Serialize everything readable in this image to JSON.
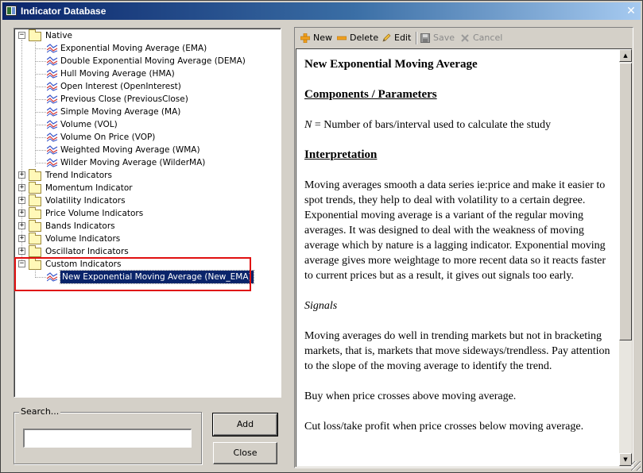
{
  "window": {
    "title": "Indicator Database",
    "close_glyph": "✕"
  },
  "tree": {
    "native": {
      "label": "Native",
      "items": [
        "Exponential Moving Average (EMA)",
        "Double Exponential Moving Average (DEMA)",
        "Hull Moving Average (HMA)",
        "Open Interest (OpenInterest)",
        "Previous Close (PreviousClose)",
        "Simple Moving Average (MA)",
        "Volume (VOL)",
        "Volume On Price (VOP)",
        "Weighted Moving Average (WMA)",
        "Wilder Moving Average (WilderMA)"
      ]
    },
    "collapsed_folders": [
      "Trend Indicators",
      "Momentum Indicator",
      "Volatility Indicators",
      "Price Volume Indicators",
      "Bands Indicators",
      "Volume Indicators",
      "Oscillator Indicators"
    ],
    "custom": {
      "label": "Custom Indicators",
      "items": [
        "New Exponential Moving Average (New_EMA)"
      ]
    },
    "expand_glyph": "+",
    "collapse_glyph": "−"
  },
  "search": {
    "label": "Search...",
    "value": ""
  },
  "buttons": {
    "add": "Add",
    "close": "Close"
  },
  "toolbar": {
    "new": "New",
    "delete": "Delete",
    "edit": "Edit",
    "save": "Save",
    "cancel": "Cancel"
  },
  "doc": {
    "title": "New Exponential Moving Average",
    "components_heading": "Components / Parameters",
    "param_symbol": "N",
    "param_text": " = Number of bars/interval used to calculate the study",
    "interpretation_heading": "Interpretation",
    "interpretation_text": "Moving averages smooth a data series ie:price and make it easier to spot trends, they help to deal with volatility to a certain degree. Exponential moving average is a variant of the regular moving averages. It was designed to deal with the weakness of moving average which by nature is a lagging indicator. Exponential moving average gives more weightage to more recent data so it reacts faster to current prices but as a result, it gives out signals too early.",
    "signals_heading": "Signals",
    "signals_text": "Moving averages do well in trending markets but not in bracketing markets, that is, markets that move sideways/trendless. Pay attention to the slope of the moving average to identify the trend.",
    "buy_text": "Buy when price crosses above moving average.",
    "cut_text": "Cut loss/take profit when price crosses below moving average."
  },
  "scrollbar": {
    "up_glyph": "▲",
    "down_glyph": "▼"
  }
}
